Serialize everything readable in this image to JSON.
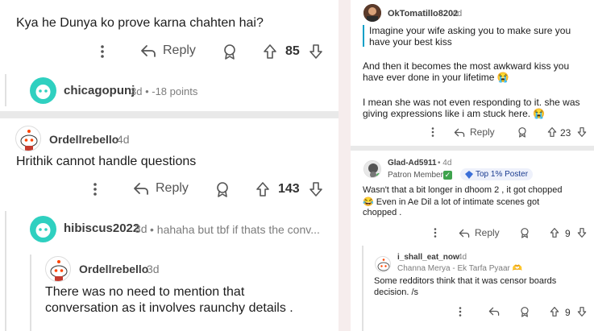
{
  "left": {
    "comment1": {
      "body": "Kya he Dunya ko prove karna chahten hai?",
      "reply_label": "Reply",
      "votes": "85"
    },
    "reply1": {
      "username": "chicagopunj",
      "meta": "3d • -18 points"
    },
    "comment2": {
      "username": "Ordellrebello",
      "time": "4d",
      "body": "Hrithik cannot handle questions",
      "reply_label": "Reply",
      "votes": "143"
    },
    "reply2": {
      "username": "hibiscus2022",
      "time": "3d",
      "preview": "• hahaha but tbf if thats the conv..."
    },
    "reply3": {
      "username": "Ordellrebello",
      "time": "3d",
      "body_line1": "There was no need to mention that",
      "body_line2": "conversation as it involves raunchy details ."
    }
  },
  "right": {
    "comment1": {
      "username": "OkTomatillo8202",
      "time": "4d",
      "quote_line1": "Imagine your wife asking you to make sure you",
      "quote_line2": "have your best kiss",
      "para1_line1": "And then it becomes the most awkward kiss you",
      "para1_line2": "have ever done in your lifetime 😭",
      "para2_line1": "I mean she was not even responding to it. she was",
      "para2_line2": "giving expressions like i am stuck here. 😭",
      "reply_label": "Reply",
      "votes": "23"
    },
    "comment2": {
      "username": "Glad-Ad5911",
      "time": "• 4d",
      "flair1": "Patron Member",
      "flair1_check": "✓",
      "flair2": "Top 1% Poster",
      "body_line1": "Wasn't that a bit longer in dhoom 2 , it got chopped",
      "body_line2": "😂 Even in Ae Dil a lot of intimate scenes got",
      "body_line3": "chopped .",
      "reply_label": "Reply",
      "votes": "9"
    },
    "comment3": {
      "username": "i_shall_eat_now",
      "time": "4d",
      "flair": "Channa Merya - Ek Tarfa Pyaar 🫶",
      "body_line1": "Some redditors think that it was censor boards",
      "body_line2": "decision. /s",
      "votes": "9"
    }
  },
  "colors": {
    "quote_bar": "#0aa0c8",
    "teal_avatar": "#2fd0c0",
    "gutter": "#f6eded",
    "flair_bg": "#eef1fb"
  }
}
